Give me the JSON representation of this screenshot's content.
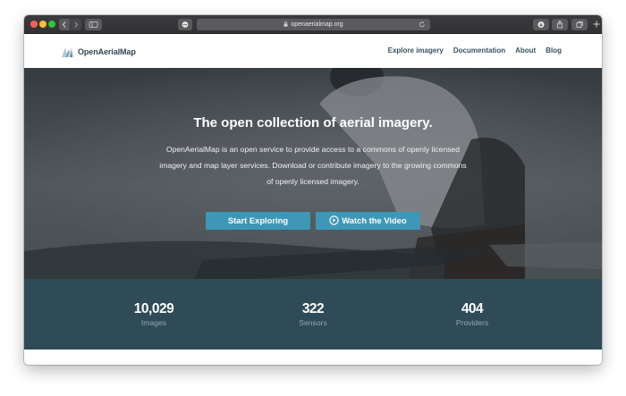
{
  "browser": {
    "url": "openaerialmap.org"
  },
  "site": {
    "logo_text": "OpenAerialMap",
    "nav": [
      {
        "label": "Explore imagery"
      },
      {
        "label": "Documentation"
      },
      {
        "label": "About"
      },
      {
        "label": "Blog"
      }
    ]
  },
  "hero": {
    "title": "The open collection of aerial imagery.",
    "lines": [
      "OpenAerialMap is an open service to provide access to a commons of openly licensed",
      "imagery and map layer services. Download or contribute imagery to the growing commons",
      "of openly licensed imagery."
    ],
    "explore_button": "Start Exploring",
    "video_button": "Watch the Video"
  },
  "stats": [
    {
      "value": "10,029",
      "label": "Images"
    },
    {
      "value": "322",
      "label": "Sensors"
    },
    {
      "value": "404",
      "label": "Providers"
    }
  ],
  "colors": {
    "accent_button": "#3e97b6",
    "stats_band": "#2f4b57",
    "header_text": "#3a5160"
  },
  "icons": [
    "back-icon",
    "forward-icon",
    "sidebar-icon",
    "extension-icon",
    "lock-icon",
    "reload-icon",
    "download-icon",
    "share-icon",
    "tabs-icon",
    "plus-icon",
    "logo-icon",
    "play-icon"
  ]
}
